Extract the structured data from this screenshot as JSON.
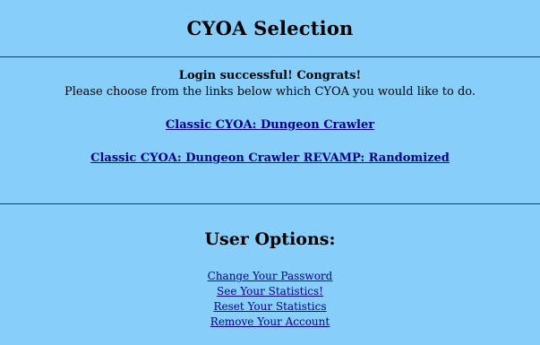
{
  "header": {
    "title": "CYOA Selection"
  },
  "main": {
    "success_message": "Login successful! Congrats!",
    "instruction": "Please choose from the links below which CYOA you would like to do.",
    "cyoa_links": [
      "Classic CYOA: Dungeon Crawler",
      "Classic CYOA: Dungeon Crawler REVAMP: Randomized"
    ]
  },
  "options": {
    "title": "User Options:",
    "links": [
      "Change Your Password",
      "See Your Statistics!",
      "Reset Your Statistics",
      "Remove Your Account"
    ]
  },
  "colors": {
    "background": "#87cefa",
    "link": "#00008b",
    "divider": "#333333"
  }
}
